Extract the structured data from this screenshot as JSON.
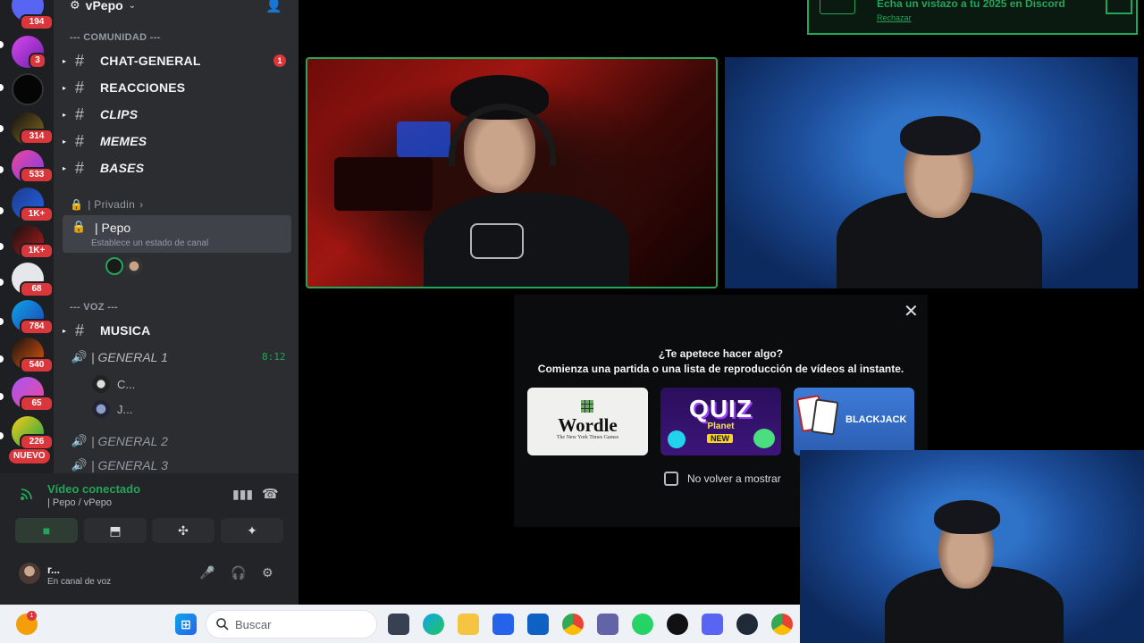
{
  "server": {
    "name": "vPepo"
  },
  "rail": {
    "badges": [
      "194",
      "3",
      "314",
      "533",
      "1K+",
      "1K+",
      "68",
      "784",
      "540",
      "65",
      "226"
    ],
    "new_label": "NUEVO"
  },
  "sidebar": {
    "category_community": "--- COMUNIDAD ---",
    "channels": [
      {
        "name": "CHAT-GENERAL",
        "mention": "1"
      },
      {
        "name": "REACCIONES"
      },
      {
        "name": "CLIPS"
      },
      {
        "name": "MEMES"
      },
      {
        "name": "BASES"
      }
    ],
    "privadin_label": "| Privadin",
    "selected_voice": {
      "name": "| Pepo",
      "status": "Establece un estado de canal"
    },
    "category_voice": "--- VOZ ---",
    "musica": "MUSICA",
    "general1": "| GENERAL 1",
    "general1_time": "8:12",
    "general1_users": [
      "C...",
      "J..."
    ],
    "general2": "| GENERAL 2",
    "general3": "| GENERAL 3"
  },
  "voice_panel": {
    "title": "Vídeo conectado",
    "subtitle": "| Pepo / vPepo"
  },
  "user_bar": {
    "name": "r...",
    "status": "En canal de voz"
  },
  "banner": {
    "text": "Echa un vistazo a tu 2025 en Discord",
    "dismiss": "Rechazar"
  },
  "activity": {
    "title": "¿Te apetece hacer algo?",
    "subtitle": "Comienza una partida o una lista de reproducción de vídeos al instante.",
    "games": [
      {
        "name": "Wordle",
        "by": "The New York Times Games"
      },
      {
        "name": "QUIZ",
        "sub": "Planet",
        "tag": "NEW"
      },
      {
        "name": "BLACKJACK"
      }
    ],
    "checkbox_label": "No volver a mostrar"
  },
  "taskbar": {
    "search_placeholder": "Buscar",
    "notif_badge": "1"
  },
  "colors": {
    "accent_green": "#23a55a",
    "danger": "#da373c",
    "sidebar": "#2b2d31",
    "rail": "#1e1f22"
  }
}
